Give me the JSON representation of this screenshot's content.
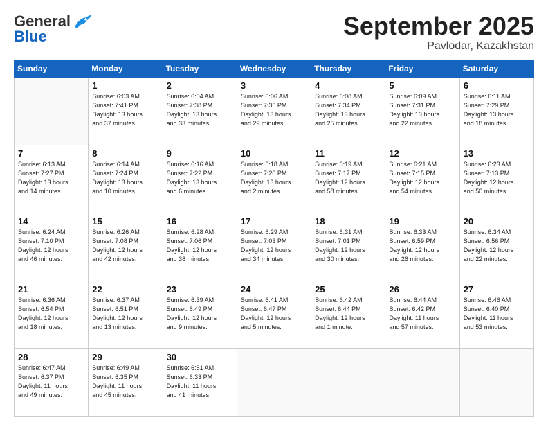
{
  "header": {
    "logo_general": "General",
    "logo_blue": "Blue",
    "month_title": "September 2025",
    "location": "Pavlodar, Kazakhstan"
  },
  "days_of_week": [
    "Sunday",
    "Monday",
    "Tuesday",
    "Wednesday",
    "Thursday",
    "Friday",
    "Saturday"
  ],
  "weeks": [
    [
      {
        "day": "",
        "info": ""
      },
      {
        "day": "1",
        "info": "Sunrise: 6:03 AM\nSunset: 7:41 PM\nDaylight: 13 hours\nand 37 minutes."
      },
      {
        "day": "2",
        "info": "Sunrise: 6:04 AM\nSunset: 7:38 PM\nDaylight: 13 hours\nand 33 minutes."
      },
      {
        "day": "3",
        "info": "Sunrise: 6:06 AM\nSunset: 7:36 PM\nDaylight: 13 hours\nand 29 minutes."
      },
      {
        "day": "4",
        "info": "Sunrise: 6:08 AM\nSunset: 7:34 PM\nDaylight: 13 hours\nand 25 minutes."
      },
      {
        "day": "5",
        "info": "Sunrise: 6:09 AM\nSunset: 7:31 PM\nDaylight: 13 hours\nand 22 minutes."
      },
      {
        "day": "6",
        "info": "Sunrise: 6:11 AM\nSunset: 7:29 PM\nDaylight: 13 hours\nand 18 minutes."
      }
    ],
    [
      {
        "day": "7",
        "info": "Sunrise: 6:13 AM\nSunset: 7:27 PM\nDaylight: 13 hours\nand 14 minutes."
      },
      {
        "day": "8",
        "info": "Sunrise: 6:14 AM\nSunset: 7:24 PM\nDaylight: 13 hours\nand 10 minutes."
      },
      {
        "day": "9",
        "info": "Sunrise: 6:16 AM\nSunset: 7:22 PM\nDaylight: 13 hours\nand 6 minutes."
      },
      {
        "day": "10",
        "info": "Sunrise: 6:18 AM\nSunset: 7:20 PM\nDaylight: 13 hours\nand 2 minutes."
      },
      {
        "day": "11",
        "info": "Sunrise: 6:19 AM\nSunset: 7:17 PM\nDaylight: 12 hours\nand 58 minutes."
      },
      {
        "day": "12",
        "info": "Sunrise: 6:21 AM\nSunset: 7:15 PM\nDaylight: 12 hours\nand 54 minutes."
      },
      {
        "day": "13",
        "info": "Sunrise: 6:23 AM\nSunset: 7:13 PM\nDaylight: 12 hours\nand 50 minutes."
      }
    ],
    [
      {
        "day": "14",
        "info": "Sunrise: 6:24 AM\nSunset: 7:10 PM\nDaylight: 12 hours\nand 46 minutes."
      },
      {
        "day": "15",
        "info": "Sunrise: 6:26 AM\nSunset: 7:08 PM\nDaylight: 12 hours\nand 42 minutes."
      },
      {
        "day": "16",
        "info": "Sunrise: 6:28 AM\nSunset: 7:06 PM\nDaylight: 12 hours\nand 38 minutes."
      },
      {
        "day": "17",
        "info": "Sunrise: 6:29 AM\nSunset: 7:03 PM\nDaylight: 12 hours\nand 34 minutes."
      },
      {
        "day": "18",
        "info": "Sunrise: 6:31 AM\nSunset: 7:01 PM\nDaylight: 12 hours\nand 30 minutes."
      },
      {
        "day": "19",
        "info": "Sunrise: 6:33 AM\nSunset: 6:59 PM\nDaylight: 12 hours\nand 26 minutes."
      },
      {
        "day": "20",
        "info": "Sunrise: 6:34 AM\nSunset: 6:56 PM\nDaylight: 12 hours\nand 22 minutes."
      }
    ],
    [
      {
        "day": "21",
        "info": "Sunrise: 6:36 AM\nSunset: 6:54 PM\nDaylight: 12 hours\nand 18 minutes."
      },
      {
        "day": "22",
        "info": "Sunrise: 6:37 AM\nSunset: 6:51 PM\nDaylight: 12 hours\nand 13 minutes."
      },
      {
        "day": "23",
        "info": "Sunrise: 6:39 AM\nSunset: 6:49 PM\nDaylight: 12 hours\nand 9 minutes."
      },
      {
        "day": "24",
        "info": "Sunrise: 6:41 AM\nSunset: 6:47 PM\nDaylight: 12 hours\nand 5 minutes."
      },
      {
        "day": "25",
        "info": "Sunrise: 6:42 AM\nSunset: 6:44 PM\nDaylight: 12 hours\nand 1 minute."
      },
      {
        "day": "26",
        "info": "Sunrise: 6:44 AM\nSunset: 6:42 PM\nDaylight: 11 hours\nand 57 minutes."
      },
      {
        "day": "27",
        "info": "Sunrise: 6:46 AM\nSunset: 6:40 PM\nDaylight: 11 hours\nand 53 minutes."
      }
    ],
    [
      {
        "day": "28",
        "info": "Sunrise: 6:47 AM\nSunset: 6:37 PM\nDaylight: 11 hours\nand 49 minutes."
      },
      {
        "day": "29",
        "info": "Sunrise: 6:49 AM\nSunset: 6:35 PM\nDaylight: 11 hours\nand 45 minutes."
      },
      {
        "day": "30",
        "info": "Sunrise: 6:51 AM\nSunset: 6:33 PM\nDaylight: 11 hours\nand 41 minutes."
      },
      {
        "day": "",
        "info": ""
      },
      {
        "day": "",
        "info": ""
      },
      {
        "day": "",
        "info": ""
      },
      {
        "day": "",
        "info": ""
      }
    ]
  ]
}
